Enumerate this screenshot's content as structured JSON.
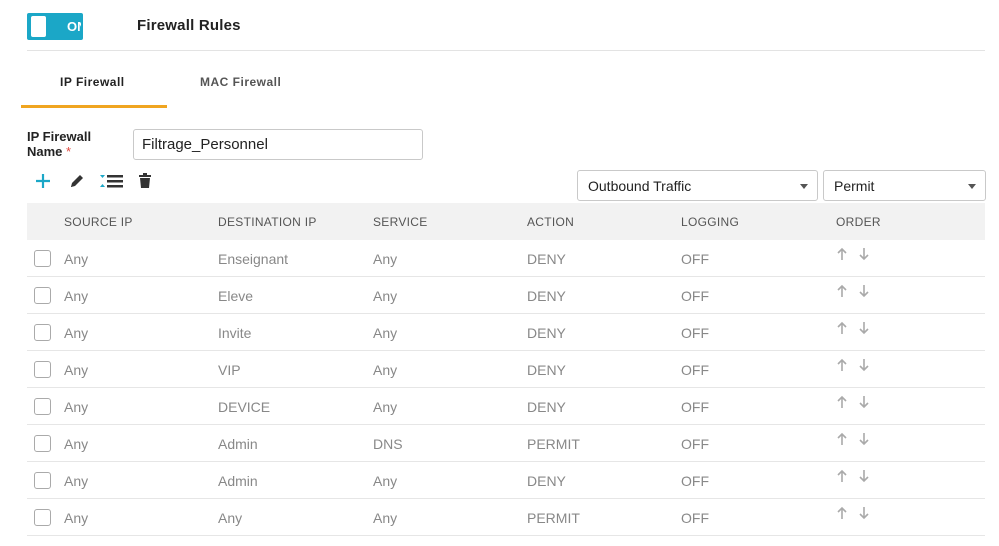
{
  "header": {
    "toggle_label": "ON",
    "title": "Firewall Rules"
  },
  "tabs": [
    {
      "label": "IP Firewall",
      "active": true
    },
    {
      "label": "MAC Firewall",
      "active": false
    }
  ],
  "form": {
    "name_label": "IP Firewall Name",
    "required_mark": "*",
    "name_value": "Filtrage_Personnel"
  },
  "toolbar": {
    "icons": [
      "add-icon",
      "edit-icon",
      "reorder-icon",
      "delete-icon"
    ],
    "traffic_select": "Outbound Traffic",
    "action_select": "Permit"
  },
  "table": {
    "columns": [
      "SOURCE IP",
      "DESTINATION IP",
      "SERVICE",
      "ACTION",
      "LOGGING",
      "ORDER"
    ],
    "rows": [
      {
        "source": "Any",
        "destination": "Enseignant",
        "service": "Any",
        "action": "DENY",
        "logging": "OFF"
      },
      {
        "source": "Any",
        "destination": "Eleve",
        "service": "Any",
        "action": "DENY",
        "logging": "OFF"
      },
      {
        "source": "Any",
        "destination": "Invite",
        "service": "Any",
        "action": "DENY",
        "logging": "OFF"
      },
      {
        "source": "Any",
        "destination": "VIP",
        "service": "Any",
        "action": "DENY",
        "logging": "OFF"
      },
      {
        "source": "Any",
        "destination": "DEVICE",
        "service": "Any",
        "action": "DENY",
        "logging": "OFF"
      },
      {
        "source": "Any",
        "destination": "Admin",
        "service": "DNS",
        "action": "PERMIT",
        "logging": "OFF"
      },
      {
        "source": "Any",
        "destination": "Admin",
        "service": "Any",
        "action": "DENY",
        "logging": "OFF"
      },
      {
        "source": "Any",
        "destination": "Any",
        "service": "Any",
        "action": "PERMIT",
        "logging": "OFF"
      }
    ]
  },
  "colors": {
    "toggle": "#1ba7c7",
    "tab_underline": "#f0a520",
    "add_icon": "#1ba7c7",
    "required": "#e0483e"
  }
}
